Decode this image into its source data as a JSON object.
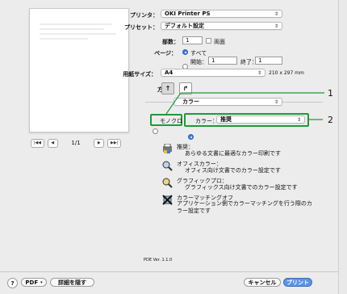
{
  "labels": {
    "printer": "プリンタ：",
    "preset": "プリセット：",
    "copies": "部数：",
    "pages": "ページ：",
    "paper_size": "用紙サイズ：",
    "orientation": "方向："
  },
  "printer": {
    "value": "OKI Printer PS"
  },
  "preset": {
    "value": "デフォルト設定"
  },
  "copies": {
    "value": "1",
    "two_sided_label": "両面"
  },
  "pages": {
    "all_label": "すべて",
    "from_label": "開始：",
    "from_value": "1",
    "to_label": "終了：",
    "to_value": "1"
  },
  "paper": {
    "value": "A4",
    "dims": "210 x 297 mm"
  },
  "panel_select": {
    "value": "カラー"
  },
  "mono": {
    "label": "モノクロ"
  },
  "color": {
    "label": "カラー：",
    "value": "推奨"
  },
  "callouts": {
    "one": "1",
    "two": "2"
  },
  "preview": {
    "page_indicator": "1/1",
    "first": "|◀◀",
    "prev": "◀",
    "next": "▶",
    "last": "▶▶|"
  },
  "descriptions": [
    {
      "icon": "printer-color-icon",
      "title": "推奨：",
      "body": "あらゆる文書に最適なカラー印刷です"
    },
    {
      "icon": "magnifier-office-icon",
      "title": "オフィスカラー：",
      "body": "オフィス向け文書でのカラー設定です"
    },
    {
      "icon": "magnifier-graphic-icon",
      "title": "グラフィックプロ：",
      "body": "グラフィックス向け文書でのカラー設定です"
    },
    {
      "icon": "color-matching-off-icon",
      "title": "カラーマッチングオフ",
      "body": "アプリケーション側でカラーマッチングを行う際のカラー設定です"
    }
  ],
  "version": "PDE Ver. 1.1.0",
  "footer": {
    "help": "?",
    "pdf": "PDF",
    "hide_details": "詳細を隠す",
    "cancel": "キャンセル",
    "print": "プリント"
  },
  "colors": {
    "accent": "#3b7cdf",
    "callout_green": "#1e9a3a"
  }
}
